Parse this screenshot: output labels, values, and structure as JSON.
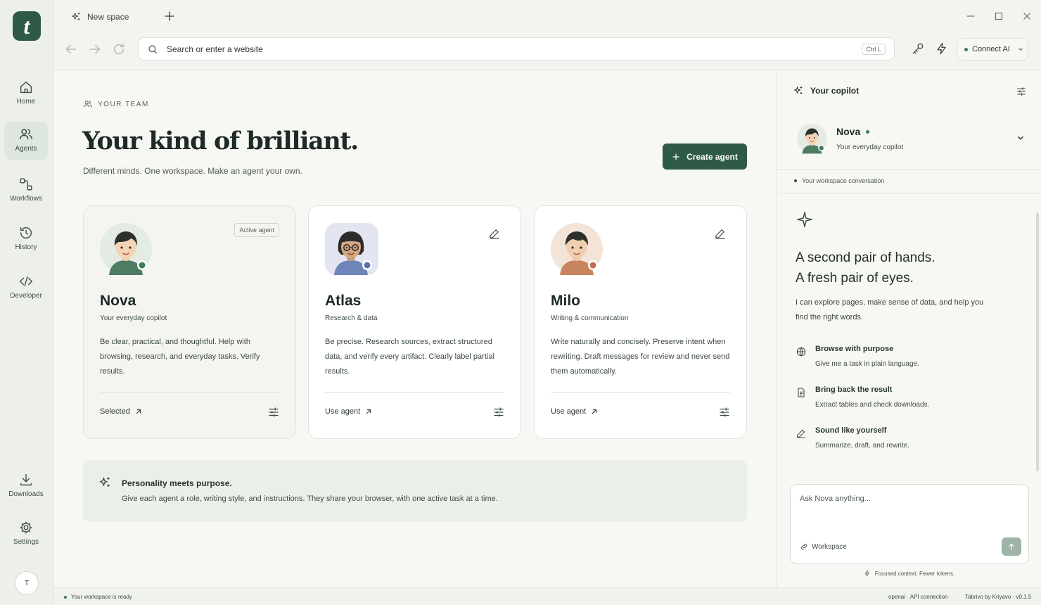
{
  "rail": {
    "logo": "t",
    "items": [
      {
        "label": "Home",
        "icon": "home-icon"
      },
      {
        "label": "Agents",
        "icon": "users-icon",
        "active": true
      },
      {
        "label": "Workflows",
        "icon": "workflow-icon"
      },
      {
        "label": "History",
        "icon": "history-icon"
      },
      {
        "label": "Developer",
        "icon": "code-icon"
      },
      {
        "label": "Downloads",
        "icon": "download-icon"
      },
      {
        "label": "Settings",
        "icon": "gear-icon"
      }
    ],
    "avatar": "T"
  },
  "tabs": [
    {
      "label": "New space",
      "icon": "sparkle-icon"
    }
  ],
  "toolbar": {
    "search_placeholder": "Search or enter a website",
    "shortcut": "Ctrl L",
    "connect_label": "Connect AI"
  },
  "main": {
    "eyebrow": "YOUR TEAM",
    "title": "Your kind of brilliant.",
    "subtitle": "Different minds. One workspace. Make an agent your own.",
    "create_label": "Create agent",
    "agents": [
      {
        "name": "Nova",
        "role": "Your everyday copilot",
        "desc": "Be clear, practical, and thoughtful. Help with browsing, research, and everyday tasks. Verify results.",
        "action": "Selected",
        "badge": "Active agent"
      },
      {
        "name": "Atlas",
        "role": "Research & data",
        "desc": "Be precise. Research sources, extract structured data, and verify every artifact. Clearly label partial results.",
        "action": "Use agent"
      },
      {
        "name": "Milo",
        "role": "Writing & communication",
        "desc": "Write naturally and concisely. Preserve intent when rewriting. Draft messages for review and never send them automatically.",
        "action": "Use agent"
      }
    ],
    "banner": {
      "title": "Personality meets purpose.",
      "desc": "Give each agent a role, writing style, and instructions. They share your browser, with one active task at a time."
    }
  },
  "copilot": {
    "header": "Your copilot",
    "agent_name": "Nova",
    "agent_role": "Your everyday copilot",
    "conversation": "Your workspace conversation",
    "hero_line1": "A second pair of hands.",
    "hero_line2": "A fresh pair of eyes.",
    "intro": "I can explore pages, make sense of data, and help you find the right words.",
    "features": [
      {
        "title": "Browse with purpose",
        "desc": "Give me a task in plain language.",
        "icon": "globe-icon"
      },
      {
        "title": "Bring back the result",
        "desc": "Extract tables and check downloads.",
        "icon": "document-icon"
      },
      {
        "title": "Sound like yourself",
        "desc": "Summarize, draft, and rewrite.",
        "icon": "pen-icon"
      }
    ],
    "input_placeholder": "Ask Nova anything...",
    "workspace_chip": "Workspace",
    "footer_note": "Focused context. Fewer tokens."
  },
  "status": {
    "left": "Your workspace is ready",
    "api": "openai · API connection",
    "version": "Tabrivo by Kriyavo · v0.1.5"
  },
  "colors": {
    "accent": "#2f5a45",
    "online": "#3f7a5c",
    "background": "#f7f7f4"
  }
}
